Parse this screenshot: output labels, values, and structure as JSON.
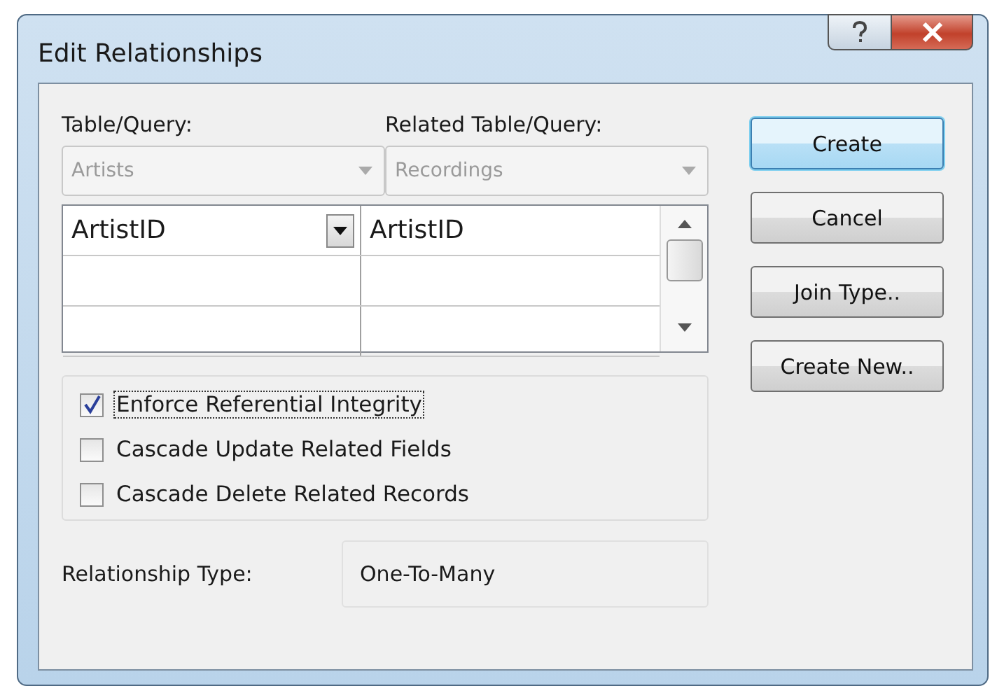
{
  "window": {
    "title": "Edit Relationships"
  },
  "table_query": {
    "label": "Table/Query:",
    "value": "Artists",
    "disabled": true
  },
  "related_table_query": {
    "label": "Related Table/Query:",
    "value": "Recordings",
    "disabled": true
  },
  "fields_grid": {
    "rows": [
      [
        "ArtistID",
        "ArtistID"
      ],
      [
        "",
        ""
      ],
      [
        "",
        ""
      ]
    ]
  },
  "options": [
    {
      "label": "Enforce Referential Integrity",
      "checked": true,
      "focused": true
    },
    {
      "label": "Cascade Update Related Fields",
      "checked": false,
      "focused": false
    },
    {
      "label": "Cascade Delete Related Records",
      "checked": false,
      "focused": false
    }
  ],
  "relationship_type": {
    "label": "Relationship Type:",
    "value": "One-To-Many"
  },
  "buttons": [
    {
      "label": "Create",
      "default": true
    },
    {
      "label": "Cancel",
      "default": false
    },
    {
      "label": "Join Type..",
      "default": false
    },
    {
      "label": "Create New..",
      "default": false
    }
  ]
}
